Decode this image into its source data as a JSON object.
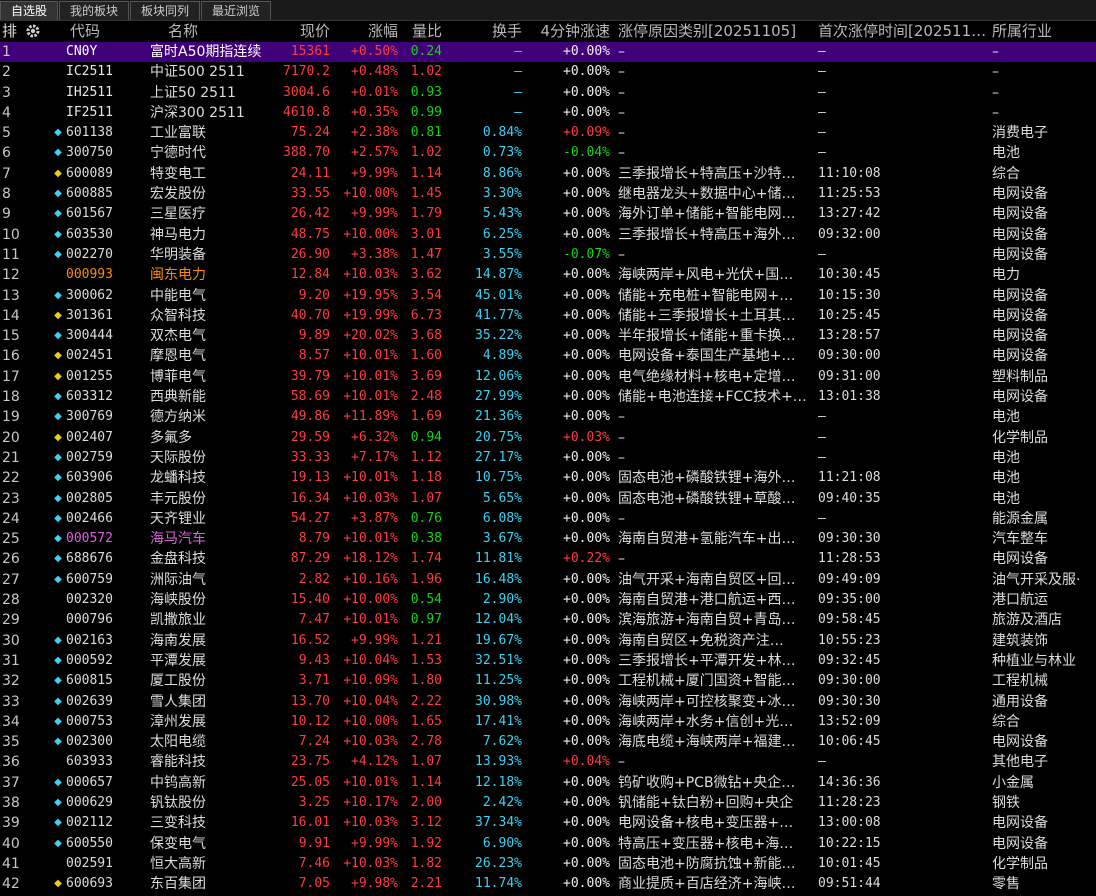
{
  "tabs": [
    "自选股",
    "我的板块",
    "板块同列",
    "最近浏览"
  ],
  "header": {
    "idx": "排",
    "code": "代码",
    "name": "名称",
    "price": "现价",
    "pct": "涨幅",
    "vr": "量比",
    "turnover": "换手",
    "speed": "4分钟涨速",
    "reason": "涨停原因类别[20251105]",
    "first_time": "首次涨停时间[202511…",
    "industry": "所属行业"
  },
  "icons": {
    "settings": "gear-icon",
    "mark": "diamond-icon"
  },
  "colors": {
    "up": "#ff3c3c",
    "down": "#16d316",
    "turnover": "#3bd3f5",
    "selected_row": "#40007a",
    "code_highlight_orange": "#ff8c00",
    "code_highlight_purple": "#e060e0"
  },
  "rows": [
    {
      "idx": "1",
      "mark": "",
      "code": "CN0Y",
      "name": "富时A50期指连续",
      "price": "15361",
      "pct": "+0.50%",
      "vr": "0.24",
      "turnover": "–",
      "speed": "+0.00%",
      "reason": "–",
      "time": "–",
      "industry": "–",
      "sel": true
    },
    {
      "idx": "2",
      "mark": "",
      "code": "IC2511",
      "name": "中证500 2511",
      "price": "7170.2",
      "pct": "+0.48%",
      "vr": "1.02",
      "turnover": "–",
      "speed": "+0.00%",
      "reason": "–",
      "time": "–",
      "industry": "–"
    },
    {
      "idx": "3",
      "mark": "",
      "code": "IH2511",
      "name": "上证50 2511",
      "price": "3004.6",
      "pct": "+0.01%",
      "vr": "0.93",
      "turnover": "–",
      "speed": "+0.00%",
      "reason": "–",
      "time": "–",
      "industry": "–"
    },
    {
      "idx": "4",
      "mark": "",
      "code": "IF2511",
      "name": "沪深300 2511",
      "price": "4610.8",
      "pct": "+0.35%",
      "vr": "0.99",
      "turnover": "–",
      "speed": "+0.00%",
      "reason": "–",
      "time": "–",
      "industry": "–"
    },
    {
      "idx": "5",
      "mark": "cyan",
      "code": "601138",
      "name": "工业富联",
      "price": "75.24",
      "pct": "+2.38%",
      "vr": "0.81",
      "turnover": "0.84%",
      "speed": "+0.09%",
      "reason": "–",
      "time": "–",
      "industry": "消费电子"
    },
    {
      "idx": "6",
      "mark": "cyan",
      "code": "300750",
      "name": "宁德时代",
      "price": "388.70",
      "pct": "+2.57%",
      "vr": "1.02",
      "turnover": "0.73%",
      "speed": "-0.04%",
      "reason": "–",
      "time": "–",
      "industry": "电池"
    },
    {
      "idx": "7",
      "mark": "yellow",
      "code": "600089",
      "name": "特变电工",
      "price": "24.11",
      "pct": "+9.99%",
      "vr": "1.14",
      "turnover": "8.86%",
      "speed": "+0.00%",
      "reason": "三季报增长+特高压+沙特…",
      "time": "11:10:08",
      "industry": "综合"
    },
    {
      "idx": "8",
      "mark": "cyan",
      "code": "600885",
      "name": "宏发股份",
      "price": "33.55",
      "pct": "+10.00%",
      "vr": "1.45",
      "turnover": "3.30%",
      "speed": "+0.00%",
      "reason": "继电器龙头+数据中心+储…",
      "time": "11:25:53",
      "industry": "电网设备"
    },
    {
      "idx": "9",
      "mark": "cyan",
      "code": "601567",
      "name": "三星医疗",
      "price": "26.42",
      "pct": "+9.99%",
      "vr": "1.79",
      "turnover": "5.43%",
      "speed": "+0.00%",
      "reason": "海外订单+储能+智能电网…",
      "time": "13:27:42",
      "industry": "电网设备"
    },
    {
      "idx": "10",
      "mark": "cyan",
      "code": "603530",
      "name": "神马电力",
      "price": "48.75",
      "pct": "+10.00%",
      "vr": "3.01",
      "turnover": "6.25%",
      "speed": "+0.00%",
      "reason": "三季报增长+特高压+海外…",
      "time": "09:32:00",
      "industry": "电网设备"
    },
    {
      "idx": "11",
      "mark": "cyan",
      "code": "002270",
      "name": "华明装备",
      "price": "26.90",
      "pct": "+3.38%",
      "vr": "1.47",
      "turnover": "3.55%",
      "speed": "-0.07%",
      "reason": "–",
      "time": "–",
      "industry": "电网设备"
    },
    {
      "idx": "12",
      "mark": "",
      "code": "000993",
      "name": "闽东电力",
      "price": "12.84",
      "pct": "+10.03%",
      "vr": "3.62",
      "turnover": "14.87%",
      "speed": "+0.00%",
      "reason": "海峡两岸+风电+光伏+国…",
      "time": "10:30:45",
      "industry": "电力",
      "hl": "orange"
    },
    {
      "idx": "13",
      "mark": "cyan",
      "code": "300062",
      "name": "中能电气",
      "price": "9.20",
      "pct": "+19.95%",
      "vr": "3.54",
      "turnover": "45.01%",
      "speed": "+0.00%",
      "reason": "储能+充电桩+智能电网+…",
      "time": "10:15:30",
      "industry": "电网设备"
    },
    {
      "idx": "14",
      "mark": "yellow",
      "code": "301361",
      "name": "众智科技",
      "price": "40.70",
      "pct": "+19.99%",
      "vr": "6.73",
      "turnover": "41.77%",
      "speed": "+0.00%",
      "reason": "储能+三季报增长+土耳其…",
      "time": "10:25:45",
      "industry": "电网设备"
    },
    {
      "idx": "15",
      "mark": "cyan",
      "code": "300444",
      "name": "双杰电气",
      "price": "9.89",
      "pct": "+20.02%",
      "vr": "3.68",
      "turnover": "35.22%",
      "speed": "+0.00%",
      "reason": "半年报增长+储能+重卡换…",
      "time": "13:28:57",
      "industry": "电网设备"
    },
    {
      "idx": "16",
      "mark": "yellow",
      "code": "002451",
      "name": "摩恩电气",
      "price": "8.57",
      "pct": "+10.01%",
      "vr": "1.60",
      "turnover": "4.89%",
      "speed": "+0.00%",
      "reason": "电网设备+泰国生产基地+…",
      "time": "09:30:00",
      "industry": "电网设备"
    },
    {
      "idx": "17",
      "mark": "yellow",
      "code": "001255",
      "name": "博菲电气",
      "price": "39.79",
      "pct": "+10.01%",
      "vr": "3.69",
      "turnover": "12.06%",
      "speed": "+0.00%",
      "reason": "电气绝缘材料+核电+定增…",
      "time": "09:31:00",
      "industry": "塑料制品"
    },
    {
      "idx": "18",
      "mark": "cyan",
      "code": "603312",
      "name": "西典新能",
      "price": "58.69",
      "pct": "+10.01%",
      "vr": "2.48",
      "turnover": "27.99%",
      "speed": "+0.00%",
      "reason": "储能+电池连接+FCC技术+…",
      "time": "13:01:38",
      "industry": "电网设备"
    },
    {
      "idx": "19",
      "mark": "cyan",
      "code": "300769",
      "name": "德方纳米",
      "price": "49.86",
      "pct": "+11.89%",
      "vr": "1.69",
      "turnover": "21.36%",
      "speed": "+0.00%",
      "reason": "–",
      "time": "–",
      "industry": "电池"
    },
    {
      "idx": "20",
      "mark": "yellow",
      "code": "002407",
      "name": "多氟多",
      "price": "29.59",
      "pct": "+6.32%",
      "vr": "0.94",
      "turnover": "20.75%",
      "speed": "+0.03%",
      "reason": "–",
      "time": "–",
      "industry": "化学制品"
    },
    {
      "idx": "21",
      "mark": "cyan",
      "code": "002759",
      "name": "天际股份",
      "price": "33.33",
      "pct": "+7.17%",
      "vr": "1.12",
      "turnover": "27.17%",
      "speed": "+0.00%",
      "reason": "–",
      "time": "–",
      "industry": "电池"
    },
    {
      "idx": "22",
      "mark": "cyan",
      "code": "603906",
      "name": "龙蟠科技",
      "price": "19.13",
      "pct": "+10.01%",
      "vr": "1.18",
      "turnover": "10.75%",
      "speed": "+0.00%",
      "reason": "固态电池+磷酸铁锂+海外…",
      "time": "11:21:08",
      "industry": "电池"
    },
    {
      "idx": "23",
      "mark": "cyan",
      "code": "002805",
      "name": "丰元股份",
      "price": "16.34",
      "pct": "+10.03%",
      "vr": "1.07",
      "turnover": "5.65%",
      "speed": "+0.00%",
      "reason": "固态电池+磷酸铁锂+草酸…",
      "time": "09:40:35",
      "industry": "电池"
    },
    {
      "idx": "24",
      "mark": "cyan",
      "code": "002466",
      "name": "天齐锂业",
      "price": "54.27",
      "pct": "+3.87%",
      "vr": "0.76",
      "turnover": "6.08%",
      "speed": "+0.00%",
      "reason": "–",
      "time": "–",
      "industry": "能源金属"
    },
    {
      "idx": "25",
      "mark": "cyan",
      "code": "000572",
      "name": "海马汽车",
      "price": "8.79",
      "pct": "+10.01%",
      "vr": "0.38",
      "turnover": "3.67%",
      "speed": "+0.00%",
      "reason": "海南自贸港+氢能汽车+出…",
      "time": "09:30:30",
      "industry": "汽车整车",
      "hl": "purple"
    },
    {
      "idx": "26",
      "mark": "cyan",
      "code": "688676",
      "name": "金盘科技",
      "price": "87.29",
      "pct": "+18.12%",
      "vr": "1.74",
      "turnover": "11.81%",
      "speed": "+0.22%",
      "reason": "–",
      "time": "11:28:53",
      "industry": "电网设备"
    },
    {
      "idx": "27",
      "mark": "cyan",
      "code": "600759",
      "name": "洲际油气",
      "price": "2.82",
      "pct": "+10.16%",
      "vr": "1.96",
      "turnover": "16.48%",
      "speed": "+0.00%",
      "reason": "油气开采+海南自贸区+回…",
      "time": "09:49:09",
      "industry": "油气开采及服·"
    },
    {
      "idx": "28",
      "mark": "",
      "code": "002320",
      "name": "海峡股份",
      "price": "15.40",
      "pct": "+10.00%",
      "vr": "0.54",
      "turnover": "2.90%",
      "speed": "+0.00%",
      "reason": "海南自贸港+港口航运+西…",
      "time": "09:35:00",
      "industry": "港口航运"
    },
    {
      "idx": "29",
      "mark": "",
      "code": "000796",
      "name": "凯撒旅业",
      "price": "7.47",
      "pct": "+10.01%",
      "vr": "0.97",
      "turnover": "12.04%",
      "speed": "+0.00%",
      "reason": "滨海旅游+海南自贸+青岛…",
      "time": "09:58:45",
      "industry": "旅游及酒店"
    },
    {
      "idx": "30",
      "mark": "cyan",
      "code": "002163",
      "name": "海南发展",
      "price": "16.52",
      "pct": "+9.99%",
      "vr": "1.21",
      "turnover": "19.67%",
      "speed": "+0.00%",
      "reason": "海南自贸区+免税资产注…",
      "time": "10:55:23",
      "industry": "建筑装饰"
    },
    {
      "idx": "31",
      "mark": "cyan",
      "code": "000592",
      "name": "平潭发展",
      "price": "9.43",
      "pct": "+10.04%",
      "vr": "1.53",
      "turnover": "32.51%",
      "speed": "+0.00%",
      "reason": "三季报增长+平潭开发+林…",
      "time": "09:32:45",
      "industry": "种植业与林业"
    },
    {
      "idx": "32",
      "mark": "cyan",
      "code": "600815",
      "name": "厦工股份",
      "price": "3.71",
      "pct": "+10.09%",
      "vr": "1.80",
      "turnover": "11.25%",
      "speed": "+0.00%",
      "reason": "工程机械+厦门国资+智能…",
      "time": "09:30:00",
      "industry": "工程机械"
    },
    {
      "idx": "33",
      "mark": "cyan",
      "code": "002639",
      "name": "雪人集团",
      "price": "13.70",
      "pct": "+10.04%",
      "vr": "2.22",
      "turnover": "30.98%",
      "speed": "+0.00%",
      "reason": "海峡两岸+可控核聚变+冰…",
      "time": "09:30:30",
      "industry": "通用设备"
    },
    {
      "idx": "34",
      "mark": "cyan",
      "code": "000753",
      "name": "漳州发展",
      "price": "10.12",
      "pct": "+10.00%",
      "vr": "1.65",
      "turnover": "17.41%",
      "speed": "+0.00%",
      "reason": "海峡两岸+水务+信创+光…",
      "time": "13:52:09",
      "industry": "综合"
    },
    {
      "idx": "35",
      "mark": "cyan",
      "code": "002300",
      "name": "太阳电缆",
      "price": "7.24",
      "pct": "+10.03%",
      "vr": "2.78",
      "turnover": "7.62%",
      "speed": "+0.00%",
      "reason": "海底电缆+海峡两岸+福建…",
      "time": "10:06:45",
      "industry": "电网设备"
    },
    {
      "idx": "36",
      "mark": "",
      "code": "603933",
      "name": "睿能科技",
      "price": "23.75",
      "pct": "+4.12%",
      "vr": "1.07",
      "turnover": "13.93%",
      "speed": "+0.04%",
      "reason": "–",
      "time": "–",
      "industry": "其他电子"
    },
    {
      "idx": "37",
      "mark": "cyan",
      "code": "000657",
      "name": "中钨高新",
      "price": "25.05",
      "pct": "+10.01%",
      "vr": "1.14",
      "turnover": "12.18%",
      "speed": "+0.00%",
      "reason": "钨矿收购+PCB微钻+央企…",
      "time": "14:36:36",
      "industry": "小金属"
    },
    {
      "idx": "38",
      "mark": "cyan",
      "code": "000629",
      "name": "钒钛股份",
      "price": "3.25",
      "pct": "+10.17%",
      "vr": "2.00",
      "turnover": "2.42%",
      "speed": "+0.00%",
      "reason": "钒储能+钛白粉+回购+央企",
      "time": "11:28:23",
      "industry": "钢铁"
    },
    {
      "idx": "39",
      "mark": "cyan",
      "code": "002112",
      "name": "三变科技",
      "price": "16.01",
      "pct": "+10.03%",
      "vr": "3.12",
      "turnover": "37.34%",
      "speed": "+0.00%",
      "reason": "电网设备+核电+变压器+…",
      "time": "13:00:08",
      "industry": "电网设备"
    },
    {
      "idx": "40",
      "mark": "cyan",
      "code": "600550",
      "name": "保变电气",
      "price": "9.91",
      "pct": "+9.99%",
      "vr": "1.92",
      "turnover": "6.90%",
      "speed": "+0.00%",
      "reason": "特高压+变压器+核电+海…",
      "time": "10:22:15",
      "industry": "电网设备"
    },
    {
      "idx": "41",
      "mark": "",
      "code": "002591",
      "name": "恒大高新",
      "price": "7.46",
      "pct": "+10.03%",
      "vr": "1.82",
      "turnover": "26.23%",
      "speed": "+0.00%",
      "reason": "固态电池+防腐抗蚀+新能…",
      "time": "10:01:45",
      "industry": "化学制品"
    },
    {
      "idx": "42",
      "mark": "yellow",
      "code": "600693",
      "name": "东百集团",
      "price": "7.05",
      "pct": "+9.98%",
      "vr": "2.21",
      "turnover": "11.74%",
      "speed": "+0.00%",
      "reason": "商业提质+百店经济+海峡…",
      "time": "09:51:44",
      "industry": "零售"
    }
  ]
}
